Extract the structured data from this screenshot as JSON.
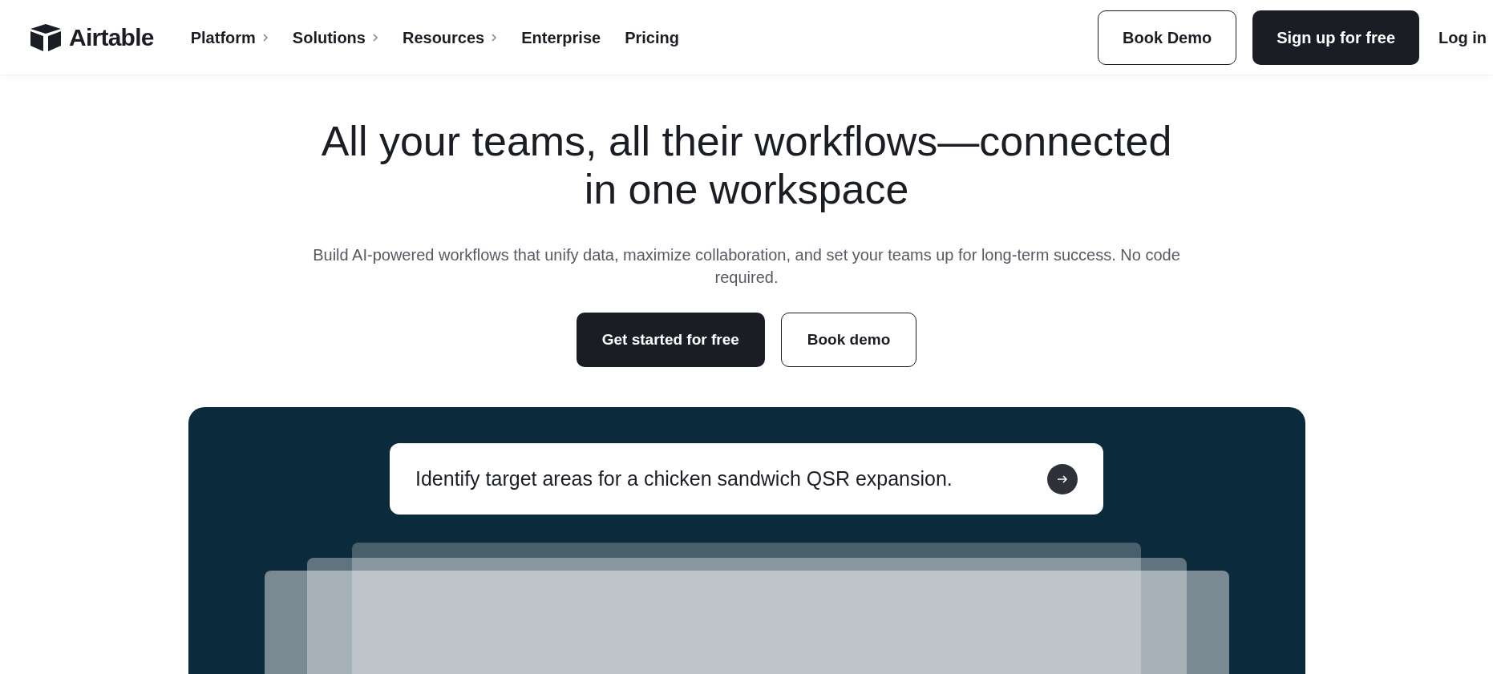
{
  "header": {
    "brand": "Airtable",
    "nav": [
      {
        "label": "Platform",
        "has_submenu": true
      },
      {
        "label": "Solutions",
        "has_submenu": true
      },
      {
        "label": "Resources",
        "has_submenu": true
      },
      {
        "label": "Enterprise",
        "has_submenu": false
      },
      {
        "label": "Pricing",
        "has_submenu": false
      }
    ],
    "actions": [
      {
        "label": "Book Demo",
        "kind": "outline"
      },
      {
        "label": "Sign up for free",
        "kind": "solid"
      },
      {
        "label": "Log in",
        "kind": "link"
      }
    ]
  },
  "hero": {
    "title_lines": [
      "All your teams, all their workflows—connected",
      "in one workspace"
    ],
    "subtitle": "Build AI-powered workflows that unify data, maximize collaboration, and set your teams up for long-term success. No code required.",
    "buttons": [
      {
        "label": "Get started for free",
        "kind": "solid"
      },
      {
        "label": "Book demo",
        "kind": "outline"
      }
    ]
  },
  "demo": {
    "prompt": "Identify target areas for a chicken sandwich QSR expansion."
  }
}
